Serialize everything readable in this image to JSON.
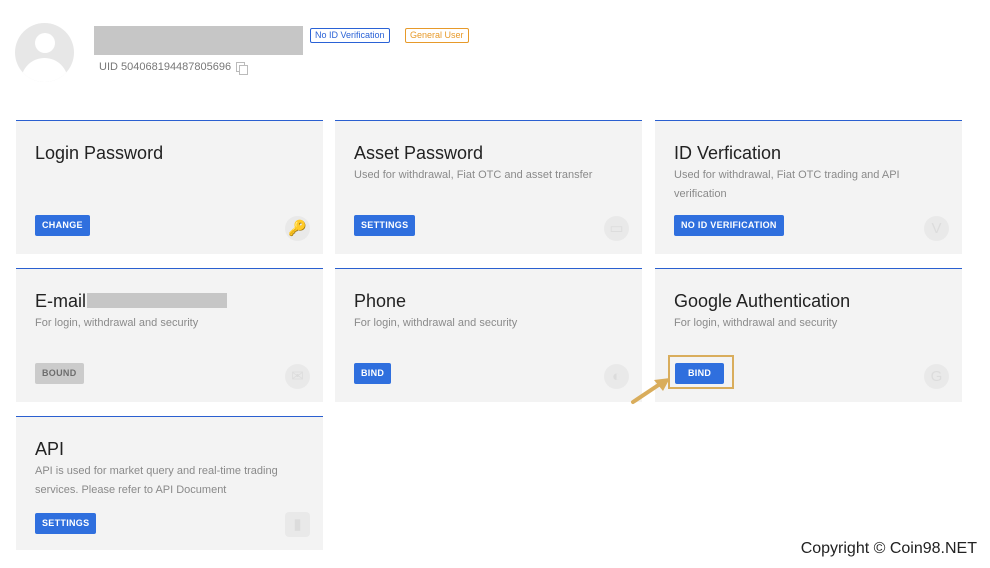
{
  "profile": {
    "badge_verification": "No ID Verification",
    "badge_user_type": "General User",
    "uid_label": "UID 504068194487805696"
  },
  "cards": {
    "login": {
      "title": "Login Password",
      "button": "CHANGE",
      "icon": "key-icon"
    },
    "asset": {
      "title": "Asset Password",
      "desc": "Used for withdrawal, Fiat OTC and asset transfer",
      "button": "SETTINGS",
      "icon": "wallet-icon"
    },
    "id": {
      "title": "ID Verfication",
      "desc": "Used for withdrawal, Fiat OTC trading and API verification",
      "button": "NO ID VERIFICATION",
      "icon": "shield-icon"
    },
    "email": {
      "title": "E-mail",
      "desc": "For login, withdrawal and security",
      "button": "BOUND",
      "icon": "mail-icon"
    },
    "phone": {
      "title": "Phone",
      "desc": "For login, withdrawal and security",
      "button": "BIND",
      "icon": "phone-icon"
    },
    "google": {
      "title": "Google Authentication",
      "desc": "For login, withdrawal and security",
      "button": "BIND",
      "icon": "google-icon"
    },
    "api": {
      "title": "API",
      "desc": "API is used for market query and real-time trading services. Please refer to API Document",
      "button": "SETTINGS",
      "icon": "api-icon"
    }
  },
  "footer": {
    "copyright": "Copyright © Coin98.NET"
  },
  "colors": {
    "accent": "#2f6fde",
    "highlight": "#d9ad5c",
    "badge_orange": "#e79a2a"
  }
}
